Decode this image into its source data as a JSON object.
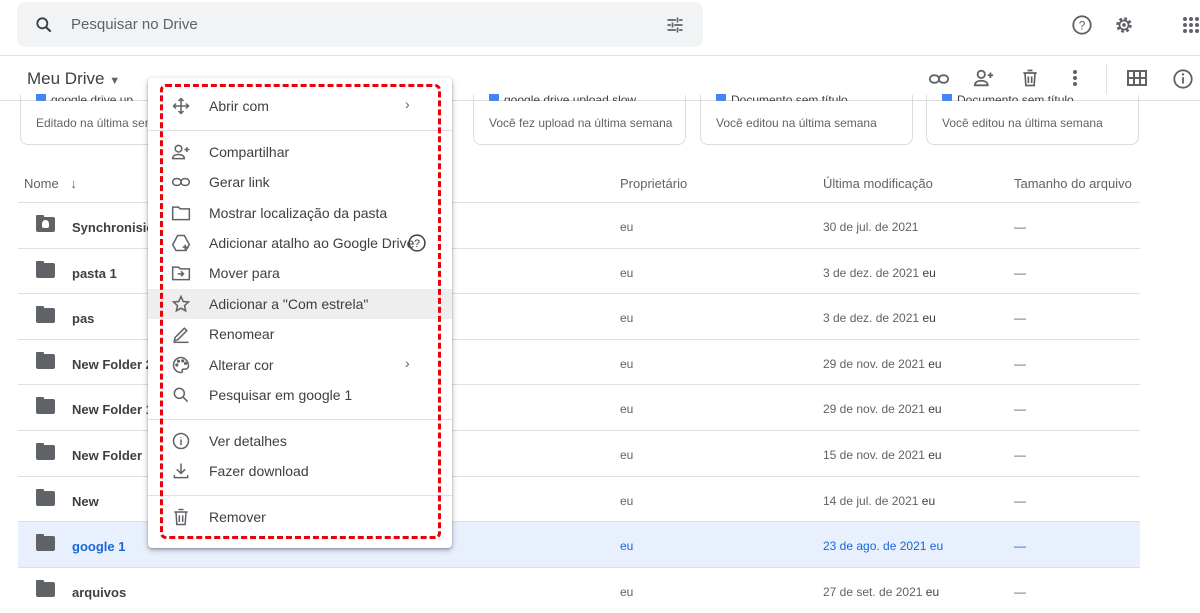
{
  "search": {
    "placeholder": "Pesquisar no Drive"
  },
  "header": {
    "title": "Meu Drive"
  },
  "cards": [
    {
      "title": "google drive up...",
      "subtitle": "Editado na última semana",
      "color": "#4285f4"
    },
    {
      "title": "google drive upload slow ...",
      "subtitle": "Você fez upload na última semana",
      "color": "#4285f4"
    },
    {
      "title": "Documento sem título",
      "subtitle": "Você editou na última semana",
      "color": "#4285f4"
    },
    {
      "title": "Documento sem título",
      "subtitle": "Você editou na última semana",
      "color": "#4285f4"
    }
  ],
  "columns": {
    "name": "Nome",
    "owner": "Proprietário",
    "modified": "Última modificação",
    "size": "Tamanho do arquivo"
  },
  "rows": [
    {
      "name": "Synchronisier",
      "owner": "eu",
      "modified": "30 de jul. de 2021",
      "by": "",
      "size": "—",
      "icon": "shared-folder-icon"
    },
    {
      "name": "pasta 1",
      "owner": "eu",
      "modified": "3 de dez. de 2021",
      "by": "eu",
      "size": "—",
      "icon": "folder-icon"
    },
    {
      "name": "pas",
      "owner": "eu",
      "modified": "3 de dez. de 2021",
      "by": "eu",
      "size": "—",
      "icon": "folder-icon"
    },
    {
      "name": "New Folder 2",
      "owner": "eu",
      "modified": "29 de nov. de 2021",
      "by": "eu",
      "size": "—",
      "icon": "folder-icon"
    },
    {
      "name": "New Folder 1",
      "owner": "eu",
      "modified": "29 de nov. de 2021",
      "by": "eu",
      "size": "—",
      "icon": "folder-icon"
    },
    {
      "name": "New Folder",
      "owner": "eu",
      "modified": "15 de nov. de 2021",
      "by": "eu",
      "size": "—",
      "icon": "folder-icon"
    },
    {
      "name": "New",
      "owner": "eu",
      "modified": "14 de jul. de 2021",
      "by": "eu",
      "size": "—",
      "icon": "folder-icon"
    },
    {
      "name": "google 1",
      "owner": "eu",
      "modified": "23 de ago. de 2021",
      "by": "eu",
      "size": "—",
      "icon": "folder-icon",
      "selected": true
    },
    {
      "name": "arquivos",
      "owner": "eu",
      "modified": "27 de set. de 2021",
      "by": "eu",
      "size": "—",
      "icon": "folder-icon"
    }
  ],
  "menu": {
    "items": [
      {
        "label": "Abrir com",
        "icon": "open-with-icon",
        "submenu": true
      },
      {
        "label": "Compartilhar",
        "icon": "add-person-icon"
      },
      {
        "label": "Gerar link",
        "icon": "link-icon"
      },
      {
        "label": "Mostrar localização da pasta",
        "icon": "folder-outline-icon"
      },
      {
        "label": "Adicionar atalho ao Google Drive",
        "icon": "add-shortcut-icon",
        "help": true
      },
      {
        "label": "Mover para",
        "icon": "move-to-icon"
      },
      {
        "label": "Adicionar a \"Com estrela\"",
        "icon": "star-icon",
        "highlighted": true
      },
      {
        "label": "Renomear",
        "icon": "pencil-icon"
      },
      {
        "label": "Alterar cor",
        "icon": "palette-icon",
        "submenu": true
      },
      {
        "label": "Pesquisar em google 1",
        "icon": "search-icon"
      },
      {
        "label": "Ver detalhes",
        "icon": "info-icon"
      },
      {
        "label": "Fazer download",
        "icon": "download-icon"
      },
      {
        "label": "Remover",
        "icon": "trash-icon"
      }
    ]
  },
  "colors": {
    "highlight_border": "#e8000b",
    "selected_row": "#e8f0fe",
    "selected_text": "#1967d2"
  }
}
